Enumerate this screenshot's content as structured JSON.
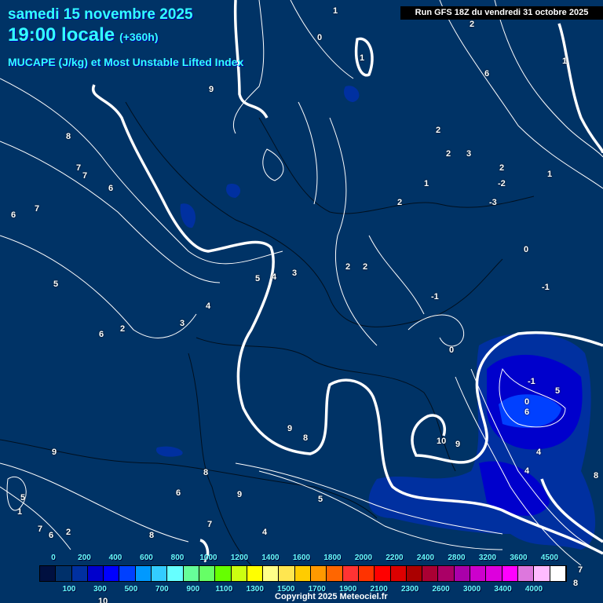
{
  "header": {
    "date": "samedi 15 novembre 2025",
    "time": "19:00 locale",
    "lead": "(+360h)",
    "parameter": "MUCAPE (J/kg) et Most Unstable Lifted Index",
    "run": "Run GFS 18Z du vendredi 31 octobre 2025"
  },
  "colors": {
    "background": "#003366",
    "scale": [
      "#001040",
      "#00306a",
      "#0030a0",
      "#0000cc",
      "#0000ff",
      "#0040ff",
      "#0099ff",
      "#33ccff",
      "#66ffff",
      "#66ff99",
      "#66ff66",
      "#66ff00",
      "#ccff11",
      "#ffff00",
      "#ffff88",
      "#ffe650",
      "#ffcc00",
      "#ff9900",
      "#ff6600",
      "#ff3333",
      "#ff3300",
      "#ff0000",
      "#dd0000",
      "#aa0000",
      "#aa0033",
      "#aa0066",
      "#aa00aa",
      "#cc00cc",
      "#dd00dd",
      "#ff00ff",
      "#dd77dd",
      "#ffbbff",
      "#ffffff"
    ]
  },
  "legend": {
    "top_ticks": [
      "0",
      "200",
      "400",
      "600",
      "800",
      "1000",
      "1200",
      "1400",
      "1600",
      "1800",
      "2000",
      "2200",
      "2400",
      "2800",
      "3200",
      "3600",
      "4500"
    ],
    "bottom_ticks": [
      "100",
      "300",
      "500",
      "700",
      "900",
      "1100",
      "1300",
      "1500",
      "1700",
      "1900",
      "2100",
      "2300",
      "2600",
      "3000",
      "3400",
      "4000"
    ]
  },
  "lifted_index_labels": [
    "1",
    "2",
    "0",
    "1",
    "1",
    "6",
    "9",
    "8",
    "7",
    "7",
    "6",
    "6",
    "7",
    "5",
    "5",
    "4",
    "3",
    "2",
    "2",
    "2",
    "2",
    "3",
    "2",
    "1",
    "1",
    "2",
    "0",
    "-1",
    "-2",
    "-3",
    "-1",
    "0",
    "-1",
    "0",
    "6",
    "5",
    "4",
    "4",
    "8",
    "9",
    "10",
    "9",
    "8",
    "8",
    "9",
    "6",
    "7",
    "5",
    "4",
    "8",
    "7",
    "6",
    "5",
    "1",
    "2",
    "2",
    "3",
    "4",
    "6",
    "7",
    "8",
    "10",
    "9"
  ],
  "copyright": "Copyright 2025 Meteociel.fr"
}
